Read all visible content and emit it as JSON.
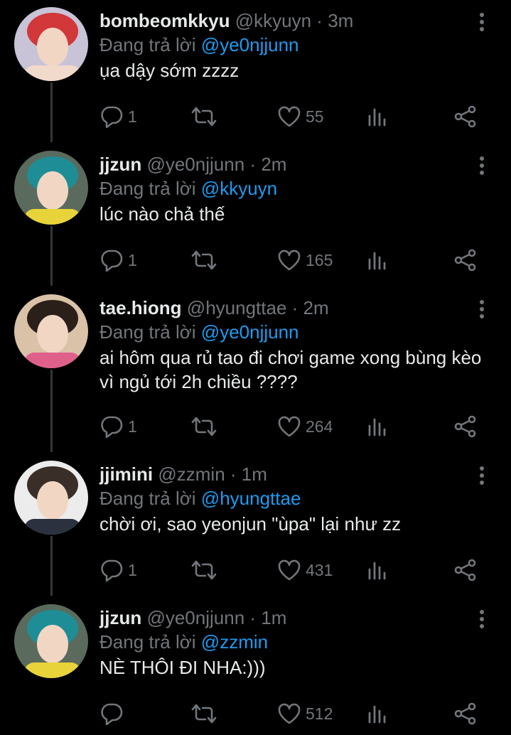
{
  "replying_prefix": "Đang trả lời",
  "tweets": [
    {
      "name": "bombeomkkyu",
      "handle": "@kkyuyn",
      "time": "3m",
      "reply_to": "@ye0njjunn",
      "text": "ụa dậy sớm zzzz",
      "replies": "1",
      "likes": "55",
      "avatar_colors": [
        "#c9c3d8",
        "#d2373a",
        "#f1d9cc"
      ]
    },
    {
      "name": "jjzun",
      "handle": "@ye0njjunn",
      "time": "2m",
      "reply_to": "@kkyuyn",
      "text": "lúc nào chả thế",
      "replies": "1",
      "likes": "165",
      "avatar_colors": [
        "#5a6b5d",
        "#1f8d95",
        "#e8d43a"
      ]
    },
    {
      "name": "tae.hiong",
      "handle": "@hyungttae",
      "time": "2m",
      "reply_to": "@ye0njjunn",
      "text": "ai hôm qua rủ tao đi chơi game xong bùng kèo vì ngủ tới 2h chiều ????",
      "replies": "1",
      "likes": "264",
      "avatar_colors": [
        "#d9c2a8",
        "#2b1f1a",
        "#e0608c"
      ]
    },
    {
      "name": "jjimini",
      "handle": "@zzmin",
      "time": "1m",
      "reply_to": "@hyungttae",
      "text": "chời ơi, sao yeonjun \"ùpa\" lại như zz",
      "replies": "1",
      "likes": "431",
      "avatar_colors": [
        "#ececec",
        "#3a2e28",
        "#2c3140"
      ]
    },
    {
      "name": "jjzun",
      "handle": "@ye0njjunn",
      "time": "1m",
      "reply_to": "@zzmin",
      "text": "NÈ THÔI ĐI NHA:)))",
      "replies": "",
      "likes": "512",
      "avatar_colors": [
        "#5a6b5d",
        "#1f8d95",
        "#e8d43a"
      ]
    }
  ],
  "icons": {
    "reply": "reply-icon",
    "retweet": "retweet-icon",
    "like": "heart-icon",
    "views": "analytics-icon",
    "share": "share-icon",
    "more": "more-vertical-icon"
  }
}
